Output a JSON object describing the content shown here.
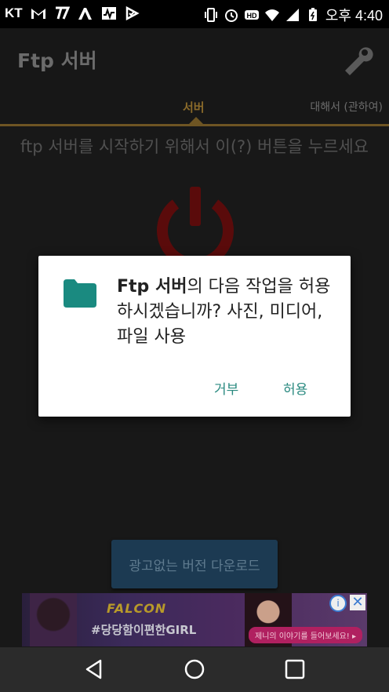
{
  "status": {
    "carrier": "KT",
    "time": "오후 4:40"
  },
  "app": {
    "title": "Ftp 서버"
  },
  "tabs": {
    "server": "서버",
    "about": "대해서 (관하여)"
  },
  "main": {
    "instruction": "ftp 서버를 시작하기 위해서 이(?) 버튼을 누르세요",
    "download_button": "광고없는 버전 다운로드"
  },
  "dialog": {
    "app_name": "Ftp 서버",
    "message_rest": "의 다음 작업을 허용하시겠습니까? 사진, 미디어, 파일 사용",
    "deny_label": "거부",
    "allow_label": "허용"
  },
  "ad": {
    "brand": "FALCON",
    "headline": "#당당함이편한GIRL",
    "cta": "제니의 이야기를 들어보세요! ▸"
  },
  "colors": {
    "accent": "#6e5523",
    "dialog_button": "#2a8a80",
    "power": "#5a0b0b"
  }
}
